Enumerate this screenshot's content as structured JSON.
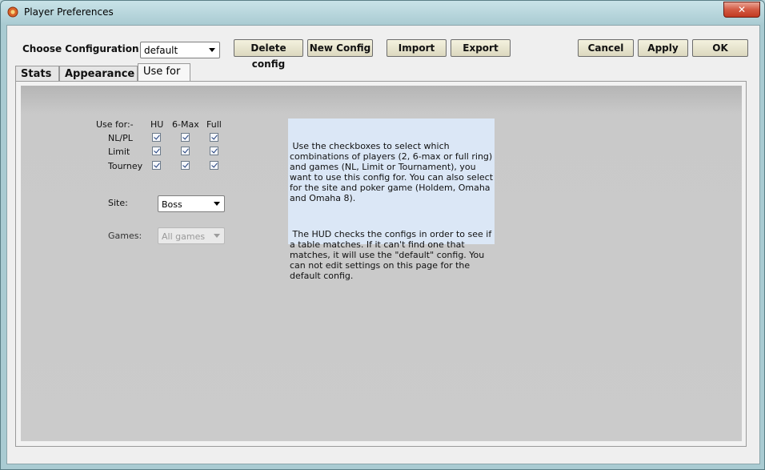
{
  "window": {
    "title": "Player Preferences",
    "close_label": "✕"
  },
  "toolbar": {
    "config_label": "Choose Configuration:",
    "config_value": "default",
    "delete_label": "Delete config",
    "new_label": "New Config",
    "import_label": "Import",
    "export_label": "Export",
    "cancel_label": "Cancel",
    "apply_label": "Apply",
    "ok_label": "OK"
  },
  "tabs": [
    {
      "label": "Stats",
      "active": false
    },
    {
      "label": "Appearance",
      "active": false
    },
    {
      "label": "Use for",
      "active": true
    }
  ],
  "use_for": {
    "header_label": "Use for:-",
    "columns": [
      "HU",
      "6-Max",
      "Full"
    ],
    "rows": [
      {
        "label": "NL/PL",
        "checked": [
          true,
          true,
          true
        ]
      },
      {
        "label": "Limit",
        "checked": [
          true,
          true,
          true
        ]
      },
      {
        "label": "Tourney",
        "checked": [
          true,
          true,
          true
        ]
      }
    ],
    "site_label": "Site:",
    "site_value": "Boss",
    "games_label": "Games:",
    "games_value": "All games",
    "help_paragraphs": [
      " Use the checkboxes to select which combinations of players (2, 6-max or full ring) and games (NL, Limit or Tournament), you want to use this config for. You can also select for the site and poker game (Holdem, Omaha and Omaha 8).",
      " The HUD checks the configs in order to see if a table matches. If it can't find one that matches, it will use the \"default\" config. You can not edit settings on this page for the default config."
    ]
  },
  "icons": {
    "app": "poker-chip-icon",
    "dropdown": "chevron-down-icon"
  }
}
